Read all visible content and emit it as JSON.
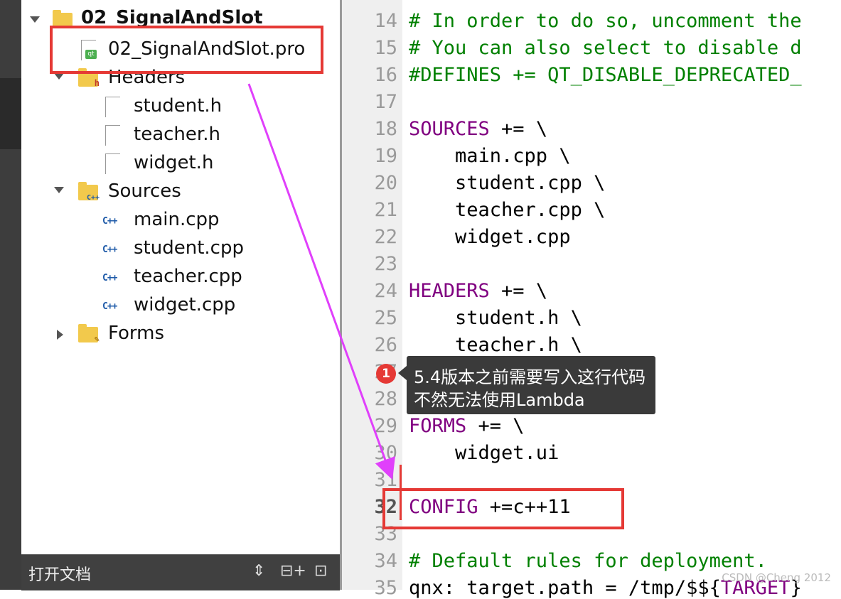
{
  "project_tree": {
    "root_label": "02_SignalAndSlot",
    "pro_file": "02_SignalAndSlot.pro",
    "headers": {
      "label": "Headers",
      "files": [
        "student.h",
        "teacher.h",
        "widget.h"
      ]
    },
    "sources": {
      "label": "Sources",
      "files": [
        "main.cpp",
        "student.cpp",
        "teacher.cpp",
        "widget.cpp"
      ]
    },
    "forms": {
      "label": "Forms"
    }
  },
  "bottom_bar": {
    "title": "打开文档",
    "icons": [
      "sort-arrows-icon",
      "split-add-icon",
      "close-pane-icon"
    ]
  },
  "editor": {
    "lines": [
      {
        "n": "14",
        "parts": [
          {
            "t": "# In order to do so, uncomment the",
            "c": "comment"
          }
        ]
      },
      {
        "n": "15",
        "parts": [
          {
            "t": "# You can also select to disable d",
            "c": "comment"
          }
        ]
      },
      {
        "n": "16",
        "parts": [
          {
            "t": "#DEFINES += QT_DISABLE_DEPRECATED_",
            "c": "comment"
          }
        ]
      },
      {
        "n": "17",
        "parts": []
      },
      {
        "n": "18",
        "parts": [
          {
            "t": "SOURCES",
            "c": "kw"
          },
          {
            "t": " += \\",
            "c": ""
          }
        ]
      },
      {
        "n": "19",
        "parts": [
          {
            "t": "    main.cpp \\",
            "c": ""
          }
        ]
      },
      {
        "n": "20",
        "parts": [
          {
            "t": "    student.cpp \\",
            "c": ""
          }
        ]
      },
      {
        "n": "21",
        "parts": [
          {
            "t": "    teacher.cpp \\",
            "c": ""
          }
        ]
      },
      {
        "n": "22",
        "parts": [
          {
            "t": "    widget.cpp",
            "c": ""
          }
        ]
      },
      {
        "n": "23",
        "parts": []
      },
      {
        "n": "24",
        "parts": [
          {
            "t": "HEADERS",
            "c": "kw"
          },
          {
            "t": " += \\",
            "c": ""
          }
        ]
      },
      {
        "n": "25",
        "parts": [
          {
            "t": "    student.h \\",
            "c": ""
          }
        ]
      },
      {
        "n": "26",
        "parts": [
          {
            "t": "    teacher.h \\",
            "c": ""
          }
        ]
      },
      {
        "n": "27",
        "parts": []
      },
      {
        "n": "28",
        "parts": []
      },
      {
        "n": "29",
        "parts": [
          {
            "t": "FORMS",
            "c": "kw"
          },
          {
            "t": " += \\",
            "c": ""
          }
        ]
      },
      {
        "n": "30",
        "parts": [
          {
            "t": "    widget.ui",
            "c": ""
          }
        ]
      },
      {
        "n": "31",
        "parts": []
      },
      {
        "n": "32",
        "parts": [
          {
            "t": "CONFIG",
            "c": "kw"
          },
          {
            "t": " +=c++11",
            "c": ""
          }
        ]
      },
      {
        "n": "33",
        "parts": []
      },
      {
        "n": "34",
        "parts": [
          {
            "t": "# Default rules for deployment.",
            "c": "comment"
          }
        ]
      },
      {
        "n": "35",
        "parts": [
          {
            "t": "qnx: target.path = /tmp/$${",
            "c": ""
          },
          {
            "t": "TARGET",
            "c": "kw"
          },
          {
            "t": "}",
            "c": ""
          }
        ]
      }
    ],
    "current_line": "32"
  },
  "annotation": {
    "badge": "1",
    "line1": "5.4版本之前需要写入这行代码",
    "line2": "不然无法使用Lambda"
  },
  "watermark": "CSDN @Cheng 2012",
  "colors": {
    "comment": "#008000",
    "keyword": "#800080",
    "highlight_box": "#e53935",
    "arrow": "#e040fb"
  }
}
